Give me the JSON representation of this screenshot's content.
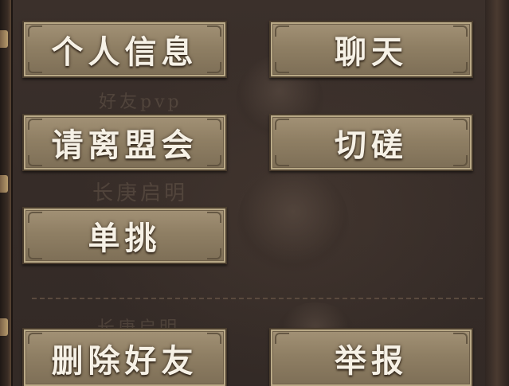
{
  "menu": {
    "buttons": [
      {
        "label": "个人信息"
      },
      {
        "label": "聊天"
      },
      {
        "label": "请离盟会"
      },
      {
        "label": "切磋"
      },
      {
        "label": "单挑"
      },
      {
        "label": "删除好友"
      },
      {
        "label": "举报"
      }
    ]
  },
  "background": {
    "ghost_texts": [
      "好友pvp",
      "长庚启明",
      "长庚启明"
    ]
  },
  "colors": {
    "button_face": "#8f7f64",
    "button_text": "#f6f1e6",
    "panel_bg": "#362c28"
  }
}
